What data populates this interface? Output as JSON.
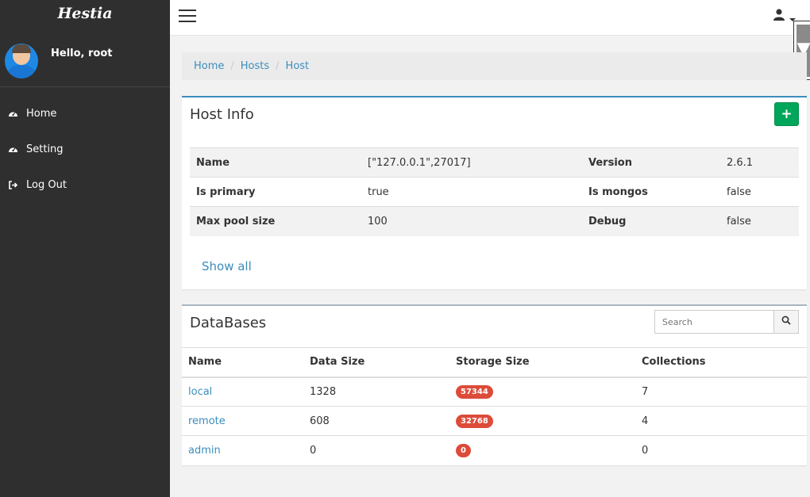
{
  "sidebar": {
    "brand": "Hestia",
    "greeting": "Hello, root",
    "items": [
      {
        "label": "Home",
        "icon": "dashboard-icon"
      },
      {
        "label": "Setting",
        "icon": "dashboard-icon"
      },
      {
        "label": "Log Out",
        "icon": "sign-out-icon"
      }
    ]
  },
  "topbar": {
    "menu_icon": "hamburger-icon",
    "user_icon": "user-icon"
  },
  "breadcrumb": [
    "Home",
    "Hosts",
    "Host"
  ],
  "host_info": {
    "title": "Host Info",
    "add_label": "+",
    "rows": [
      {
        "k1": "Name",
        "v1": "[\"127.0.0.1\",27017]",
        "k2": "Version",
        "v2": "2.6.1"
      },
      {
        "k1": "Is primary",
        "v1": "true",
        "k2": "Is mongos",
        "v2": "false"
      },
      {
        "k1": "Max pool size",
        "v1": "100",
        "k2": "Debug",
        "v2": "false"
      }
    ],
    "show_all": "Show all"
  },
  "databases": {
    "title": "DataBases",
    "search_placeholder": "Search",
    "columns": [
      "Name",
      "Data Size",
      "Storage Size",
      "Collections"
    ],
    "rows": [
      {
        "name": "local",
        "data_size": "1328",
        "storage_size": "57344",
        "collections": "7"
      },
      {
        "name": "remote",
        "data_size": "608",
        "storage_size": "32768",
        "collections": "4"
      },
      {
        "name": "admin",
        "data_size": "0",
        "storage_size": "0",
        "collections": "0"
      }
    ]
  },
  "colors": {
    "sidebar_bg": "#2f2f2f",
    "link": "#3c8dbc",
    "success": "#00a65a",
    "badge": "#dd4b39"
  }
}
